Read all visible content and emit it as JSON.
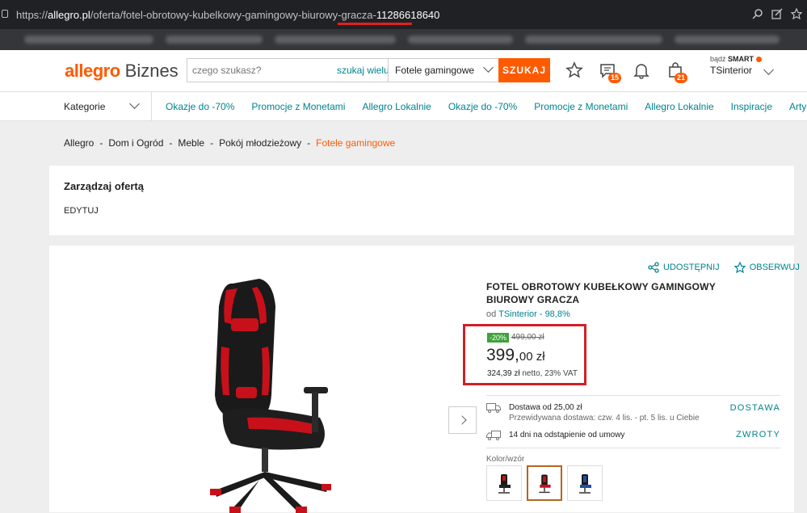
{
  "browser": {
    "url_prefix": "https://",
    "url_host": "allegro.pl",
    "url_path": "/oferta/fotel-obrotowy-kubelkowy-gamingowy-biurowy-gracza-",
    "url_id": "11286618640"
  },
  "header": {
    "logo_main": "allegro",
    "logo_sub": "Biznes",
    "search_placeholder": "czego szukasz?",
    "search_many": "szukaj wielu",
    "search_category": "Fotele gamingowe",
    "search_button": "SZUKAJ",
    "messages_count": "15",
    "cart_count": "21",
    "smart_prefix": "bądź",
    "smart_label": "SMART",
    "username": "TSinterior"
  },
  "nav": {
    "categories_label": "Kategorie",
    "links": [
      "Okazje do -70%",
      "Promocje z Monetami",
      "Allegro Lokalnie",
      "Okazje do -70%",
      "Promocje z Monetami",
      "Allegro Lokalnie",
      "Inspiracje",
      "Artykuły"
    ]
  },
  "breadcrumbs": {
    "items": [
      "Allegro",
      "Dom i Ogród",
      "Meble",
      "Pokój młodzieżowy"
    ],
    "current": "Fotele gamingowe",
    "separator": "-"
  },
  "manage": {
    "title": "Zarządzaj ofertą",
    "edit": "EDYTUJ"
  },
  "product": {
    "share": "UDOSTĘPNIJ",
    "watch": "OBSERWUJ",
    "title": "FOTEL OBROTOWY KUBEŁKOWY GAMINGOWY BIUROWY GRACZA",
    "seller_prefix": "od",
    "seller_name": "TSinterior - 98,8%",
    "discount": "-20%",
    "old_price": "499,00 zł",
    "price_main": "399,",
    "price_cents": "00 zł",
    "netto_value": "324,39 zł",
    "netto_suffix": " netto, 23% VAT",
    "delivery_line1": "Dostawa od 25,00 zł",
    "delivery_line2": "Przewidywana dostawa: czw. 4 lis. - pt. 5 lis. u Ciebie",
    "delivery_link": "DOSTAWA",
    "returns_line": "14 dni na odstąpienie od umowy",
    "returns_link": "ZWROTY",
    "color_label": "Kolor/wzór"
  },
  "colors": {
    "accent": "#ff5a00",
    "link": "#00838f",
    "highlight": "#d21f26",
    "discount_badge": "#3ea33a"
  }
}
